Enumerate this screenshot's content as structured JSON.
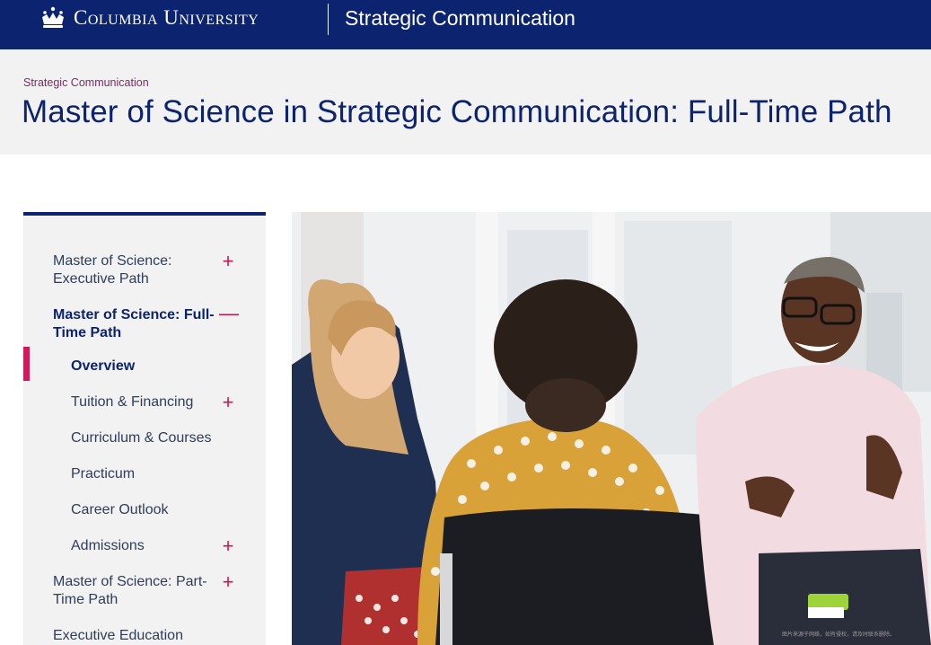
{
  "header": {
    "university": "Columbia University",
    "site_title": "Strategic Communication"
  },
  "banner": {
    "breadcrumb": "Strategic Communication",
    "title": "Master of Science in Strategic Communication: Full-Time Path"
  },
  "sidebar": {
    "items": [
      {
        "label": "Master of Science: Executive Path",
        "toggle": "+"
      },
      {
        "label": "Master of Science: Full-Time Path",
        "toggle": "—"
      },
      {
        "label": "Overview"
      },
      {
        "label": "Tuition & Financing",
        "toggle": "+"
      },
      {
        "label": "Curriculum & Courses"
      },
      {
        "label": "Practicum"
      },
      {
        "label": "Career Outlook"
      },
      {
        "label": "Admissions",
        "toggle": "+"
      },
      {
        "label": "Master of Science: Part-Time Path",
        "toggle": "+"
      },
      {
        "label": "Executive Education"
      }
    ]
  },
  "photo": {
    "watermark": "图片来源于网络，如有侵权，请及时联系删除。"
  },
  "colors": {
    "navy": "#0c2470",
    "accent": "#d0185a",
    "breadcrumb": "#7b2a63"
  }
}
